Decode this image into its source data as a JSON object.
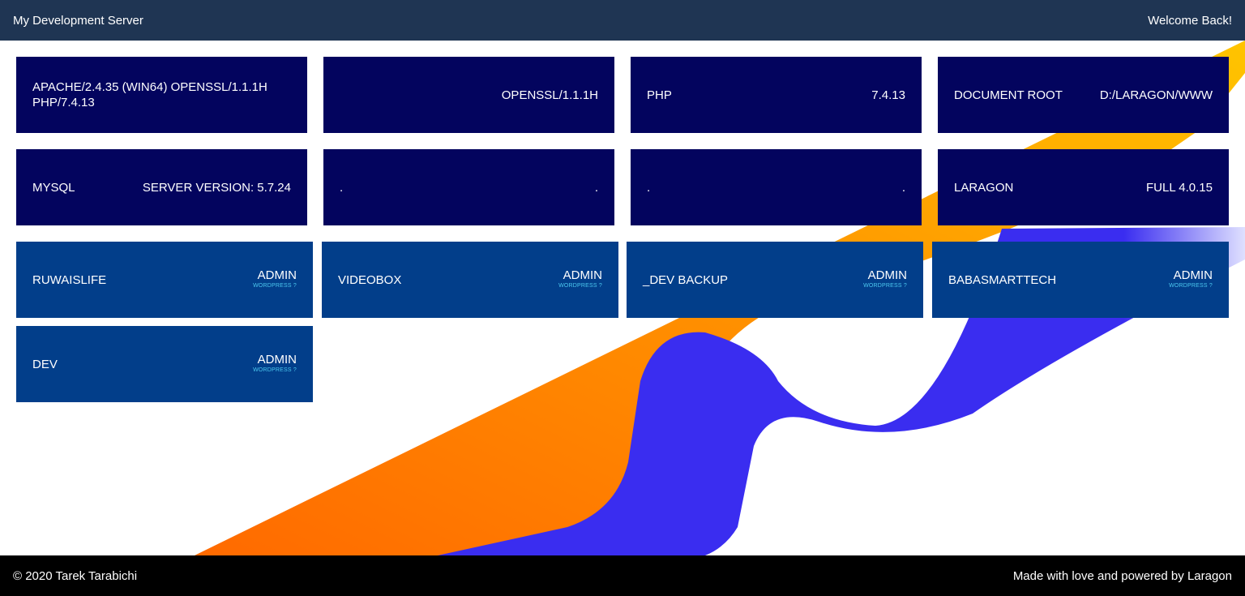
{
  "header": {
    "title": "My Development Server",
    "welcome": "Welcome Back!"
  },
  "info_tiles": [
    {
      "label": "APACHE/2.4.35 (WIN64) OPENSSL/1.1.1H PHP/7.4.13",
      "value": ""
    },
    {
      "label": "",
      "value": "OPENSSL/1.1.1H"
    },
    {
      "label": "PHP",
      "value": "7.4.13"
    },
    {
      "label": "DOCUMENT ROOT",
      "value": "D:/LARAGON/WWW"
    },
    {
      "label": "MYSQL",
      "value": "SERVER VERSION: 5.7.24"
    },
    {
      "label": ".",
      "value": "."
    },
    {
      "label": ".",
      "value": "."
    },
    {
      "label": "LARAGON",
      "value": "FULL 4.0.15"
    }
  ],
  "projects": [
    {
      "name": "RUWAISLIFE",
      "admin": "ADMIN",
      "platform": "WORDPRESS ?"
    },
    {
      "name": "VIDEOBOX",
      "admin": "ADMIN",
      "platform": "WORDPRESS ?"
    },
    {
      "name": "_DEV BACKUP",
      "admin": "ADMIN",
      "platform": "WORDPRESS ?"
    },
    {
      "name": "BABASMARTTECH",
      "admin": "ADMIN",
      "platform": "WORDPRESS ?"
    },
    {
      "name": "DEV",
      "admin": "ADMIN",
      "platform": "WORDPRESS ?"
    }
  ],
  "footer": {
    "copyright": "© 2020 Tarek Tarabichi",
    "credit": "Made with love and powered by Laragon"
  },
  "colors": {
    "header_bg": "#1f3553",
    "info_tile_bg": "#03045e",
    "project_tile_bg": "#023e8a",
    "footer_bg": "#000000",
    "orange": "#ff8a00",
    "yellow": "#ffc300",
    "blue": "#3a2df0"
  }
}
